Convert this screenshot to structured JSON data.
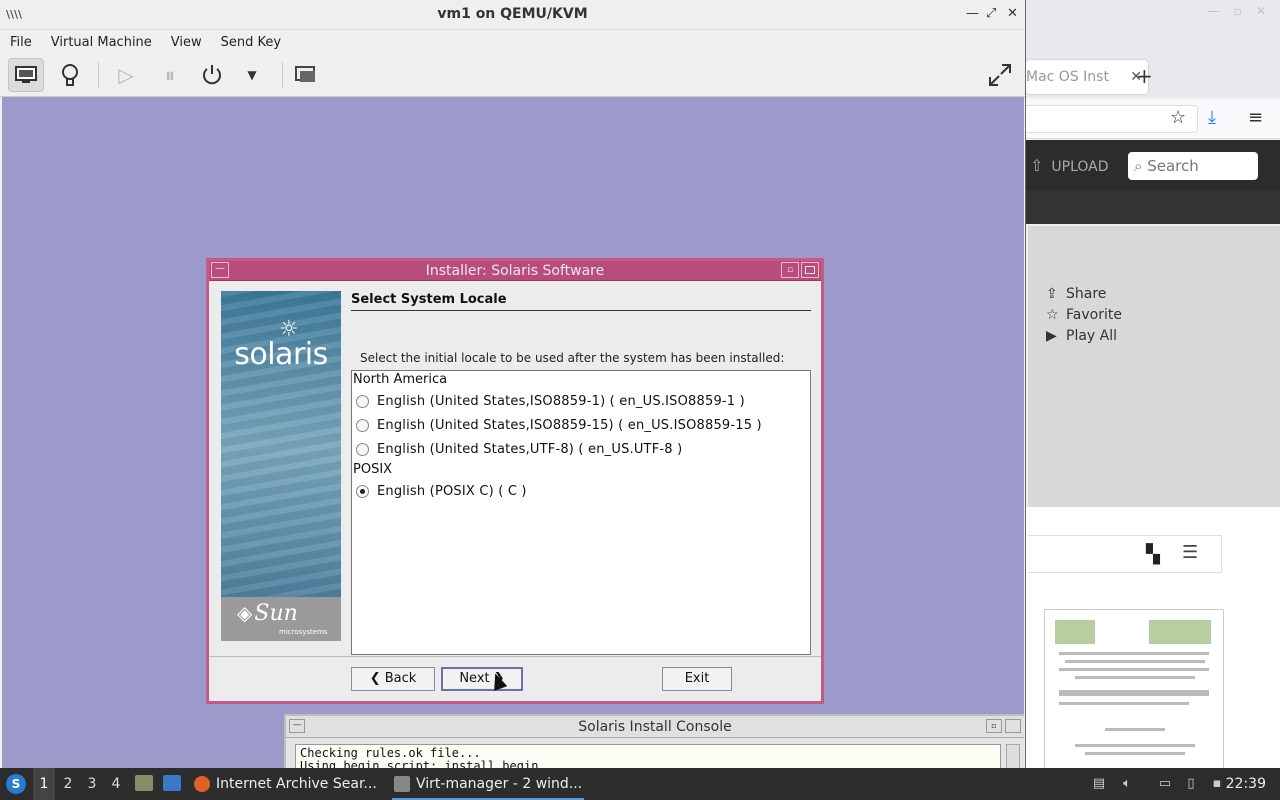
{
  "browser": {
    "tab_label": "Mac OS Inst",
    "new_tab_symbol": "+",
    "upload_label": "UPLOAD",
    "search_placeholder": "Search",
    "actions": [
      {
        "icon": "share-icon",
        "label": "Share"
      },
      {
        "icon": "star-icon",
        "label": "Favorite"
      },
      {
        "icon": "play-icon",
        "label": "Play All"
      }
    ]
  },
  "vm": {
    "title": "vm1 on QEMU/KVM",
    "menu": [
      "File",
      "Virtual Machine",
      "View",
      "Send Key"
    ],
    "toolbar": {
      "console_icon": "monitor-icon",
      "details_icon": "lightbulb-icon",
      "run_icon": "play-icon",
      "pause_icon": "pause-icon",
      "power_icon": "power-icon",
      "power_menu_icon": "chevron-down-icon",
      "snapshot_icon": "snapshots-icon",
      "fullscreen_icon": "fullscreen-icon"
    }
  },
  "installer": {
    "window_title": "Installer: Solaris Software",
    "brand": "solaris",
    "vendor": "Sun",
    "vendor_sub": "microsystems",
    "heading": "Select System Locale",
    "instruction": "Select the initial locale to be used after the system has been installed:",
    "groups": [
      {
        "name": "North America",
        "options": [
          {
            "label": "English (United States,ISO8859-1) ( en_US.ISO8859-1 )",
            "selected": false
          },
          {
            "label": "English (United States,ISO8859-15) ( en_US.ISO8859-15 )",
            "selected": false
          },
          {
            "label": "English (United States,UTF-8) ( en_US.UTF-8 )",
            "selected": false
          }
        ]
      },
      {
        "name": "POSIX",
        "options": [
          {
            "label": "English (POSIX C) ( C )",
            "selected": true
          }
        ]
      }
    ],
    "buttons": {
      "back": "Back",
      "next": "Next",
      "exit": "Exit"
    }
  },
  "console": {
    "title": "Solaris Install Console",
    "lines": [
      "Checking rules.ok file...",
      "Using begin script: install_begin"
    ]
  },
  "taskbar": {
    "workspaces": [
      "1",
      "2",
      "3",
      "4"
    ],
    "current_workspace": "1",
    "tasks": [
      {
        "label": "Internet Archive Sear...",
        "icon": "firefox-icon"
      },
      {
        "label": "Virt-manager - 2 wind...",
        "icon": "virt-manager-icon"
      }
    ],
    "clock": "22:39"
  }
}
